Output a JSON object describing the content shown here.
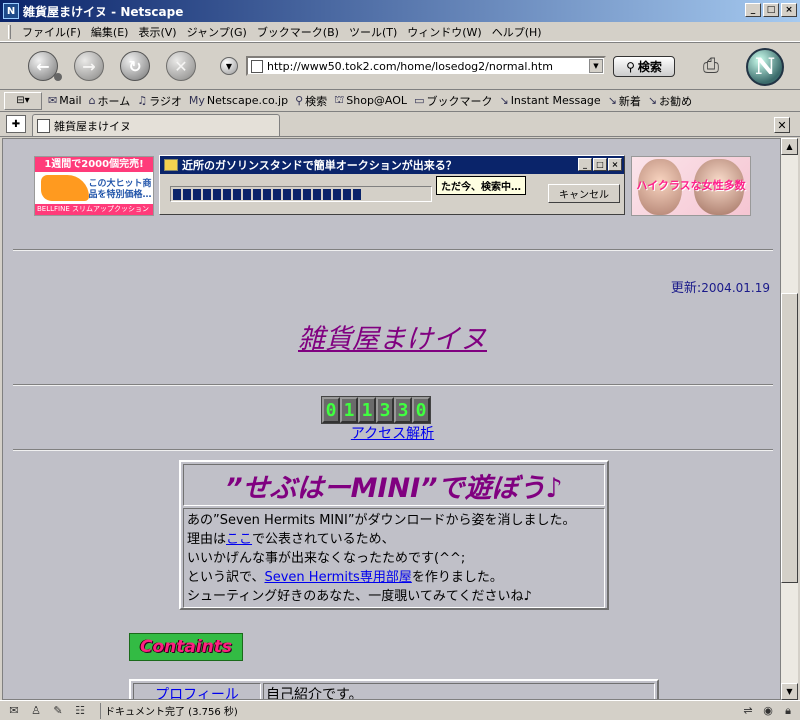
{
  "window": {
    "title": "雑貨屋まけイヌ - Netscape",
    "buttons": {
      "minimize": "_",
      "maximize": "□",
      "close": "×"
    }
  },
  "menu": [
    "ファイル(F)",
    "編集(E)",
    "表示(V)",
    "ジャンプ(G)",
    "ブックマーク(B)",
    "ツール(T)",
    "ウィンドウ(W)",
    "ヘルプ(H)"
  ],
  "navigation": {
    "url": "http://www50.tok2.com/home/losedog2/normal.htm",
    "search_label": "検索"
  },
  "bookmarks": [
    {
      "label": "Mail",
      "icon": "mail-icon",
      "glyph": "✉"
    },
    {
      "label": "ホーム",
      "icon": "home-icon",
      "glyph": "⌂"
    },
    {
      "label": "ラジオ",
      "icon": "headphones-icon",
      "glyph": "♫"
    },
    {
      "label": "Netscape.co.jp",
      "icon": "my-icon",
      "glyph": "My"
    },
    {
      "label": "検索",
      "icon": "search-icon",
      "glyph": "⚲"
    },
    {
      "label": "Shop@AOL",
      "icon": "shop-icon",
      "glyph": "⛫"
    },
    {
      "label": "ブックマーク",
      "icon": "folder-icon",
      "glyph": "▭"
    },
    {
      "label": "Instant Message",
      "icon": "link-icon",
      "glyph": "↘"
    },
    {
      "label": "新着",
      "icon": "link-icon",
      "glyph": "↘"
    },
    {
      "label": "お勧め",
      "icon": "link-icon",
      "glyph": "↘"
    }
  ],
  "tab": {
    "label": "雑貨屋まけイヌ"
  },
  "ads": {
    "left": {
      "top_text": "1週間で2000個完売!",
      "middle_text": "この大ヒット商品を特別価格…",
      "bottom_text": "BELLFINE スリムアップクッション"
    },
    "dialog": {
      "title": "近所のガソリンスタンドで簡単オークションが出来る？",
      "tooltip": "ただ今、検索中…",
      "cancel": "キャンセル",
      "progress_blocks": 19
    },
    "right": {
      "text": "ハイクラスな女性多数"
    }
  },
  "page": {
    "update_label": "更新:",
    "update_date": "2004.01.19",
    "site_title": "雑貨屋まけイヌ",
    "counter_digits": [
      "0",
      "1",
      "1",
      "3",
      "3",
      "0"
    ],
    "access_link": "アクセス解析",
    "mini": {
      "title": "”せぶはーMINI”で遊ぼう♪",
      "line1": "あの”Seven Hermits MINI”がダウンロードから姿を消しました。",
      "line2_pre": "理由は",
      "line2_link": "ここ",
      "line2_post": "で公表されているため、",
      "line3": "いいかげんな事が出来なくなったためです(^^;",
      "line4_pre": "という訳で、",
      "line4_link": "Seven Hermits専用部屋",
      "line4_post": "を作りました。",
      "line5": "シューティング好きのあなた、一度覗いてみてくださいね♪"
    },
    "contents_image_text": "Containts",
    "contents_rows": [
      {
        "link": "プロフィール",
        "desc": "自己紹介です。"
      }
    ]
  },
  "status": {
    "text": "ドキュメント完了 (3.756 秒)"
  },
  "colors": {
    "title_purple": "#800080",
    "link_blue": "#0000ee",
    "counter_green": "#40ff40"
  }
}
